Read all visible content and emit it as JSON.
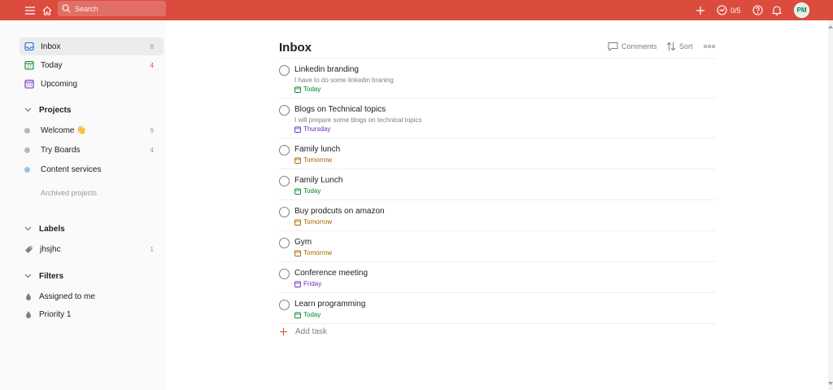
{
  "colors": {
    "brand": "#db4c3f",
    "today": "#058527",
    "tomorrow": "#ad6200",
    "upcoming": "#692fc2",
    "inbox": "#246fe0"
  },
  "topbar": {
    "menu_icon": "hamburger-icon",
    "home_icon": "home-icon",
    "search_placeholder": "Search",
    "add_icon": "plus-icon",
    "karma_value": "0/5",
    "help_icon": "question-icon",
    "notifications_icon": "bell-icon",
    "avatar_initials": "PM"
  },
  "sidebar": {
    "inbox": {
      "label": "Inbox",
      "count": "8"
    },
    "today": {
      "label": "Today",
      "count": "4",
      "day_number": "27"
    },
    "upcoming": {
      "label": "Upcoming"
    },
    "projects": {
      "title": "Projects",
      "items": [
        {
          "label": "Welcome",
          "emoji": "👋",
          "count": "9",
          "color": "#b8b8b8"
        },
        {
          "label": "Try Boards",
          "count": "4",
          "color": "#b8b8b8"
        },
        {
          "label": "Content services",
          "count": "",
          "color": "#96c3eb"
        }
      ],
      "archived_label": "Archived projects"
    },
    "labels": {
      "title": "Labels",
      "items": [
        {
          "label": "jhsjhc",
          "count": "1"
        }
      ]
    },
    "filters": {
      "title": "Filters",
      "items": [
        {
          "label": "Assigned to me"
        },
        {
          "label": "Priority 1"
        }
      ]
    }
  },
  "main": {
    "title": "Inbox",
    "actions": {
      "comments": "Comments",
      "sort": "Sort",
      "more_icon": "ellipsis-icon"
    },
    "tasks": [
      {
        "name": "Linkedin branding",
        "description": "I have to do some linkedin braning",
        "due": "Today",
        "due_type": "today"
      },
      {
        "name": "Blogs on Technical topics",
        "description": "I will prepare some blogs on technical topics",
        "due": "Thursday",
        "due_type": "upcoming"
      },
      {
        "name": "Family lunch",
        "description": "",
        "due": "Tomorrow",
        "due_type": "tomorrow"
      },
      {
        "name": "Family Lunch",
        "description": "",
        "due": "Today",
        "due_type": "today"
      },
      {
        "name": "Buy prodcuts on amazon",
        "description": "",
        "due": "Tomorrow",
        "due_type": "tomorrow"
      },
      {
        "name": "Gym",
        "description": "",
        "due": "Tomorrow",
        "due_type": "tomorrow"
      },
      {
        "name": "Conference meeting",
        "description": "",
        "due": "Friday",
        "due_type": "upcoming"
      },
      {
        "name": "Learn programming",
        "description": "",
        "due": "Today",
        "due_type": "today"
      }
    ],
    "add_task_label": "Add task"
  }
}
